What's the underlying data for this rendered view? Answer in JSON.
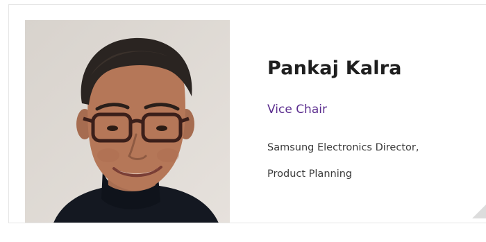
{
  "profile": {
    "name": "Pankaj Kalra",
    "role": "Vice Chair",
    "company": "Samsung Electronics Director,",
    "department": "Product Planning"
  },
  "colors": {
    "role_accent": "#5b2d8e",
    "name_text": "#1f1f1f",
    "body_text": "#3a3a3a",
    "card_border": "#e6e6e6"
  },
  "icons": {
    "corner": "page-curl-icon"
  }
}
